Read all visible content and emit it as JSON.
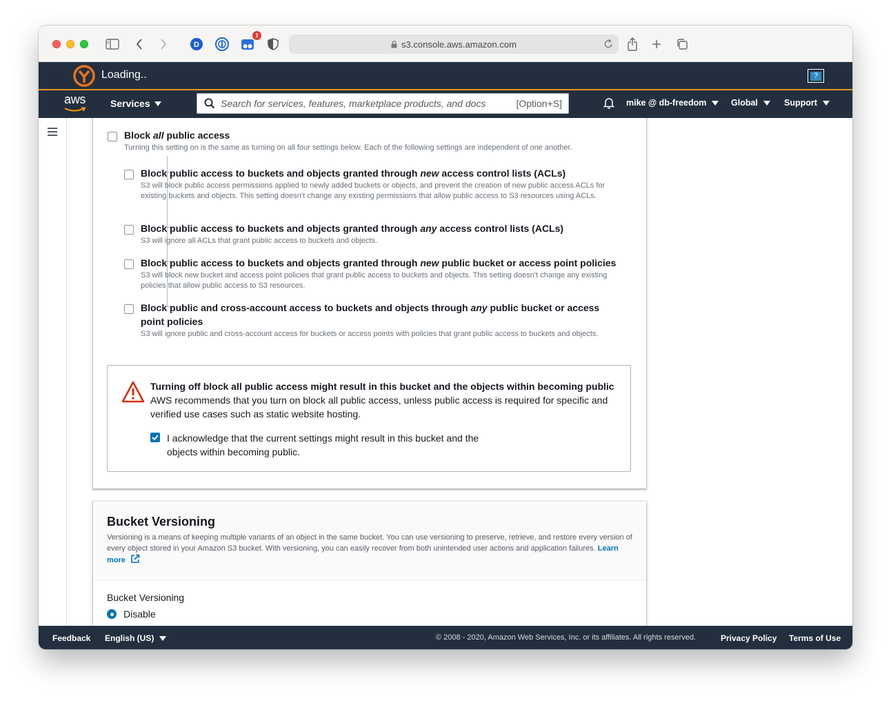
{
  "browser": {
    "url": "s3.console.aws.amazon.com",
    "extension_badge": "1"
  },
  "extension_bar": {
    "status": "Loading.."
  },
  "nav": {
    "logo": "aws",
    "services_label": "Services",
    "search_placeholder": "Search for services, features, marketplace products, and docs",
    "search_shortcut": "[Option+S]",
    "account": "mike @ db-freedom",
    "region": "Global",
    "support": "Support"
  },
  "block_public_access": {
    "all": {
      "title_pre": "Block ",
      "title_em": "all",
      "title_post": " public access",
      "desc": "Turning this setting on is the same as turning on all four settings below. Each of the following settings are independent of one another.",
      "checked": false
    },
    "options": [
      {
        "title_pre": "Block public access to buckets and objects granted through ",
        "title_em": "new",
        "title_post": " access control lists (ACLs)",
        "desc": "S3 will block public access permissions applied to newly added buckets or objects, and prevent the creation of new public access ACLs for existing buckets and objects. This setting doesn’t change any existing permissions that allow public access to S3 resources using ACLs.",
        "checked": false
      },
      {
        "title_pre": "Block public access to buckets and objects granted through ",
        "title_em": "any",
        "title_post": " access control lists (ACLs)",
        "desc": "S3 will ignore all ACLs that grant public access to buckets and objects.",
        "checked": false
      },
      {
        "title_pre": "Block public access to buckets and objects granted through ",
        "title_em": "new",
        "title_post": " public bucket or access point policies",
        "desc": "S3 will block new bucket and access point policies that grant public access to buckets and objects. This setting doesn't change any existing policies that allow public access to S3 resources.",
        "checked": false
      },
      {
        "title_pre": "Block public and cross-account access to buckets and objects through ",
        "title_em": "any",
        "title_post": " public bucket or access point policies",
        "desc": "S3 will ignore public and cross-account access for buckets or access points with policies that grant public access to buckets and objects.",
        "checked": false
      }
    ]
  },
  "warning": {
    "title": "Turning off block all public access might result in this bucket and the objects within becoming public",
    "text": "AWS recommends that you turn on block all public access, unless public access is required for specific and verified use cases such as static website hosting.",
    "ack_label": "I acknowledge that the current settings might result in this bucket and the objects within becoming public.",
    "ack_checked": true
  },
  "versioning": {
    "title": "Bucket Versioning",
    "desc": "Versioning is a means of keeping multiple variants of an object in the same bucket. You can use versioning to preserve, retrieve, and restore every version of every object stored in your Amazon S3 bucket. With versioning, you can easily recover from both unintended user actions and application failures.",
    "learn_more": "Learn more",
    "field_label": "Bucket Versioning",
    "option_disable": "Disable"
  },
  "footer": {
    "feedback": "Feedback",
    "language": "English (US)",
    "copyright": "© 2008 - 2020, Amazon Web Services, Inc. or its affiliates. All rights reserved.",
    "privacy": "Privacy Policy",
    "terms": "Terms of Use"
  },
  "colors": {
    "nav_bg": "#232f3e",
    "accent_orange": "#e8951c",
    "link_blue": "#0073bb",
    "warning_red": "#d13212"
  }
}
